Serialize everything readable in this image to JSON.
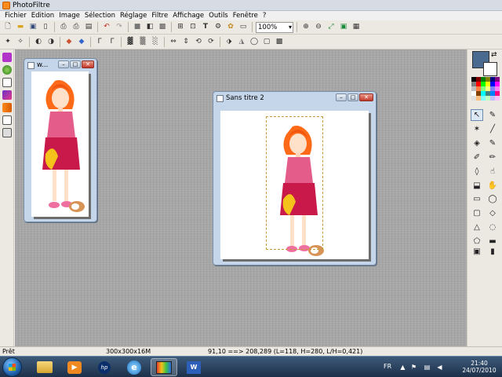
{
  "app": {
    "title": "PhotoFiltre"
  },
  "menu": [
    "Fichier",
    "Edition",
    "Image",
    "Sélection",
    "Réglage",
    "Filtre",
    "Affichage",
    "Outils",
    "Fenêtre",
    "?"
  ],
  "toolbar": {
    "zoom_value": "100%",
    "text_tool_glyph": "T"
  },
  "documents": [
    {
      "title": "w...",
      "min": "–",
      "max": "□",
      "close": "✕"
    },
    {
      "title": "Sans titre 2",
      "min": "–",
      "max": "□",
      "close": "✕"
    }
  ],
  "status": {
    "state": "Prêt",
    "image_size": "300x300x16M",
    "coords": "91,10 ==> 208,289 (L=118, H=280, L/H=0,421)"
  },
  "taskbar": {
    "language": "FR",
    "time": "21:40",
    "date": "24/07/2010"
  },
  "colors": {
    "foreground": "#4a6a8f",
    "background": "#ffffff"
  }
}
